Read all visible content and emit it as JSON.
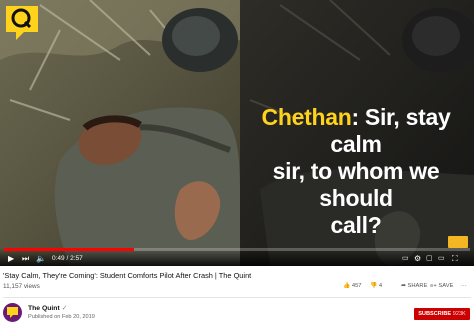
{
  "caption": {
    "speaker": "Chethan",
    "line1_rest": ": Sir, stay calm",
    "line2": "sir, to whom we should",
    "line3": "call?"
  },
  "player": {
    "current_time": "0:49",
    "duration": "2:57",
    "progress_fraction": 0.28
  },
  "video": {
    "title": "'Stay Calm, They're Coming': Student Comforts Pilot After Crash | The Quint",
    "views": "11,157 views",
    "likes": "457",
    "dislikes": "4",
    "share_label": "SHARE",
    "save_label": "SAVE"
  },
  "channel": {
    "name": "The Quint",
    "published": "Published on Feb 20, 2019",
    "subscribe_label": "SUBSCRIBE",
    "subscriber_count": "923K"
  },
  "colors": {
    "accent": "#ffd21c",
    "progress": "#ff0000",
    "subscribe": "#cc0000"
  },
  "icons": [
    "quint-logo-icon",
    "play-icon",
    "next-icon",
    "volume-icon",
    "subtitles-icon",
    "settings-icon",
    "miniplayer-icon",
    "theater-icon",
    "fullscreen-icon",
    "like-icon",
    "dislike-icon",
    "share-icon",
    "save-icon",
    "more-icon"
  ]
}
